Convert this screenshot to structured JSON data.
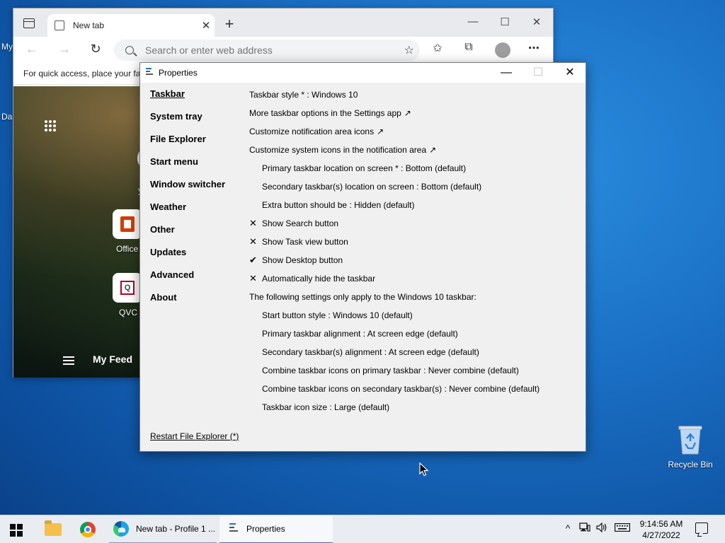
{
  "desktop": {
    "edge_text_1": "My",
    "edge_text_2": "Da",
    "recycle_bin_label": "Recycle Bin"
  },
  "browser": {
    "tab_title": "New tab",
    "tab_close": "✕",
    "new_tab": "+",
    "minimize": "—",
    "maximize": "☐",
    "close": "✕",
    "back": "←",
    "forward": "→",
    "refresh": "↻",
    "address_placeholder": "Search or enter web address",
    "favorites_bar_text": "For quick access, place your fa",
    "tiles": [
      {
        "label": "Office"
      },
      {
        "label": "QVC"
      }
    ],
    "qvc_glyph": "Q",
    "feed_title": "My Feed",
    "partial_label": "y"
  },
  "properties": {
    "title": "Properties",
    "minimize": "—",
    "maximize": "☐",
    "close": "✕",
    "nav": [
      {
        "label": "Taskbar",
        "active": true
      },
      {
        "label": "System tray"
      },
      {
        "label": "File Explorer"
      },
      {
        "label": "Start menu"
      },
      {
        "label": "Window switcher"
      },
      {
        "label": "Weather"
      },
      {
        "label": "Other"
      },
      {
        "label": "Updates"
      },
      {
        "label": "Advanced"
      },
      {
        "label": "About"
      }
    ],
    "settings": {
      "taskbar_style": "Taskbar style * : Windows 10",
      "more_options": "More taskbar options in the Settings app",
      "notif_icons": "Customize notification area icons",
      "system_icons": "Customize system icons in the notification area",
      "primary_location": "Primary taskbar location on screen * : Bottom (default)",
      "secondary_location": "Secondary taskbar(s) location on screen : Bottom (default)",
      "extra_button": "Extra button should be : Hidden (default)",
      "show_search": "Show Search button",
      "show_taskview": "Show Task view button",
      "show_desktop": "Show Desktop button",
      "autohide": "Automatically hide the taskbar",
      "win10_note": "The following settings only apply to the Windows 10 taskbar:",
      "start_style": "Start button style : Windows 10 (default)",
      "primary_align": "Primary taskbar alignment : At screen edge (default)",
      "secondary_align": "Secondary taskbar(s) alignment : At screen edge (default)",
      "combine_primary": "Combine taskbar icons on primary taskbar : Never combine (default)",
      "combine_secondary": "Combine taskbar icons on secondary taskbar(s) : Never combine (default)",
      "icon_size": "Taskbar icon size : Large (default)"
    },
    "marks": {
      "cross": "✕",
      "check": "✔",
      "external": "↗"
    },
    "footer_link": "Restart File Explorer (*)"
  },
  "taskbar": {
    "edge_task": "New tab - Profile 1 ...",
    "props_task": "Properties",
    "tray_chevron": "^",
    "tray_volume": "🔊",
    "time": "9:14:56 AM",
    "date": "4/27/2022"
  },
  "icons": [
    "windows-start-icon",
    "file-explorer-icon",
    "chrome-icon",
    "edge-icon",
    "properties-app-icon",
    "network-icon",
    "volume-icon",
    "keyboard-icon",
    "notification-icon",
    "recycle-bin-icon"
  ]
}
